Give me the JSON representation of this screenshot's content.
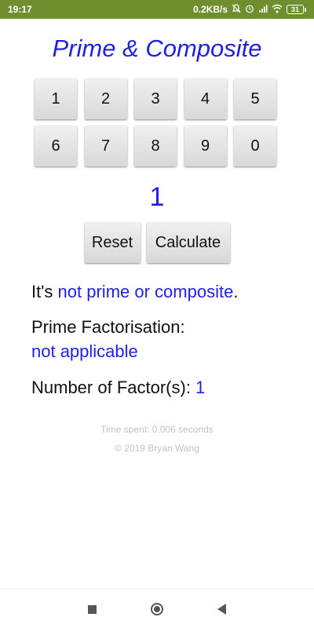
{
  "status_bar": {
    "time": "19:17",
    "network_speed": "0.2KB/s",
    "battery": "31",
    "icons": [
      "mute-icon",
      "alarm-icon",
      "signal-icon",
      "wifi-icon",
      "battery-icon"
    ]
  },
  "app": {
    "title": "Prime & Composite",
    "keys": [
      "1",
      "2",
      "3",
      "4",
      "5",
      "6",
      "7",
      "8",
      "9",
      "0"
    ],
    "display_number": "1",
    "reset_label": "Reset",
    "calculate_label": "Calculate",
    "result_prefix": "It's ",
    "result_value": "not prime or composite",
    "result_suffix": ".",
    "factorisation_label": "Prime Factorisation:",
    "factorisation_value": "not applicable",
    "factor_count_label": "Number of Factor(s): ",
    "factor_count_value": "1",
    "time_spent": "Time spent: 0.006 seconds",
    "copyright": "© 2019 Bryan Wang"
  },
  "nav_bar": {
    "icons": [
      "recents-square-icon",
      "home-circle-icon",
      "back-triangle-icon"
    ]
  },
  "colors": {
    "accent_blue": "#1f1fe6",
    "status_bar": "#6f8f2f",
    "footer_grey": "#c2c2c2"
  }
}
